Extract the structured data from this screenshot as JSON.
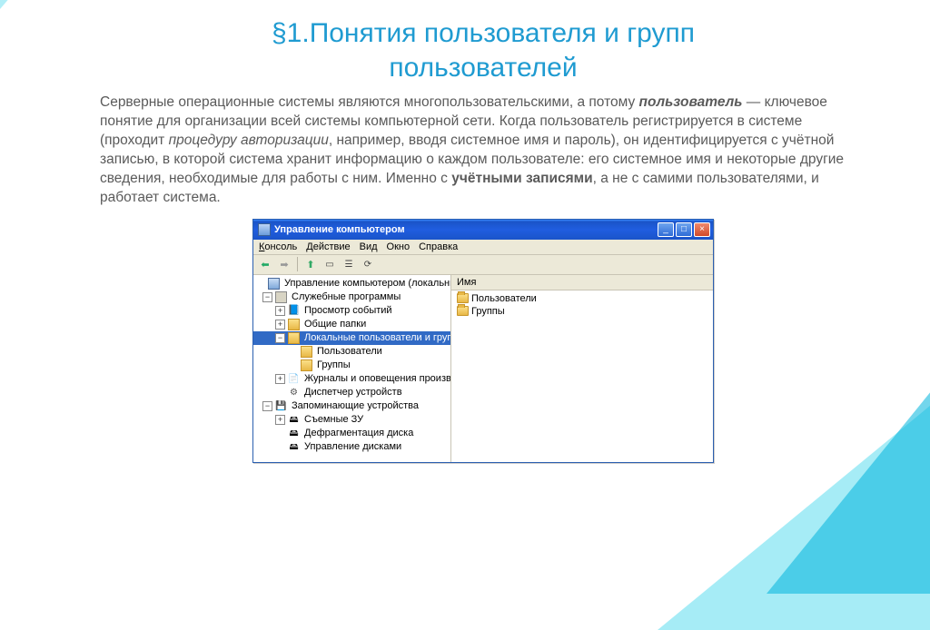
{
  "title_line1": "§1.Понятия пользователя и групп",
  "title_line2": "пользователей",
  "paragraph": {
    "p1": "Серверные операционные системы являются многопользовательскими, а потому ",
    "p2_bolditalic": "пользователь",
    "p3": " — ключевое понятие для организации всей системы компьютерной сети. Когда пользователь регистрируется в системе (проходит ",
    "p4_italic": "процедуру авторизации",
    "p5": ", например, вводя системное имя и пароль), он идентифицируется с учётной записью, в которой система хранит информацию о каждом пользователе: его системное имя и некоторые другие сведения, необходимые для работы с ним. Именно с ",
    "p6_bold": "учётными записями",
    "p7": ", а не с самими пользователями, и работает система."
  },
  "window": {
    "title": "Управление компьютером",
    "menu": {
      "console": "Консоль",
      "action": "Действие",
      "view": "Вид",
      "window": "Окно",
      "help": "Справка"
    },
    "list_header": "Имя",
    "list_items": [
      "Пользователи",
      "Группы"
    ],
    "tree": {
      "root": "Управление компьютером (локальным)",
      "services": "Служебные программы",
      "events": "Просмотр событий",
      "shared": "Общие папки",
      "local_users": "Локальные пользователи и группы",
      "users": "Пользователи",
      "groups": "Группы",
      "logs": "Журналы и оповещения производитель",
      "devmgr": "Диспетчер устройств",
      "storage": "Запоминающие устройства",
      "removable": "Съемные ЗУ",
      "defrag": "Дефрагментация диска",
      "diskmgmt": "Управление дисками"
    }
  }
}
